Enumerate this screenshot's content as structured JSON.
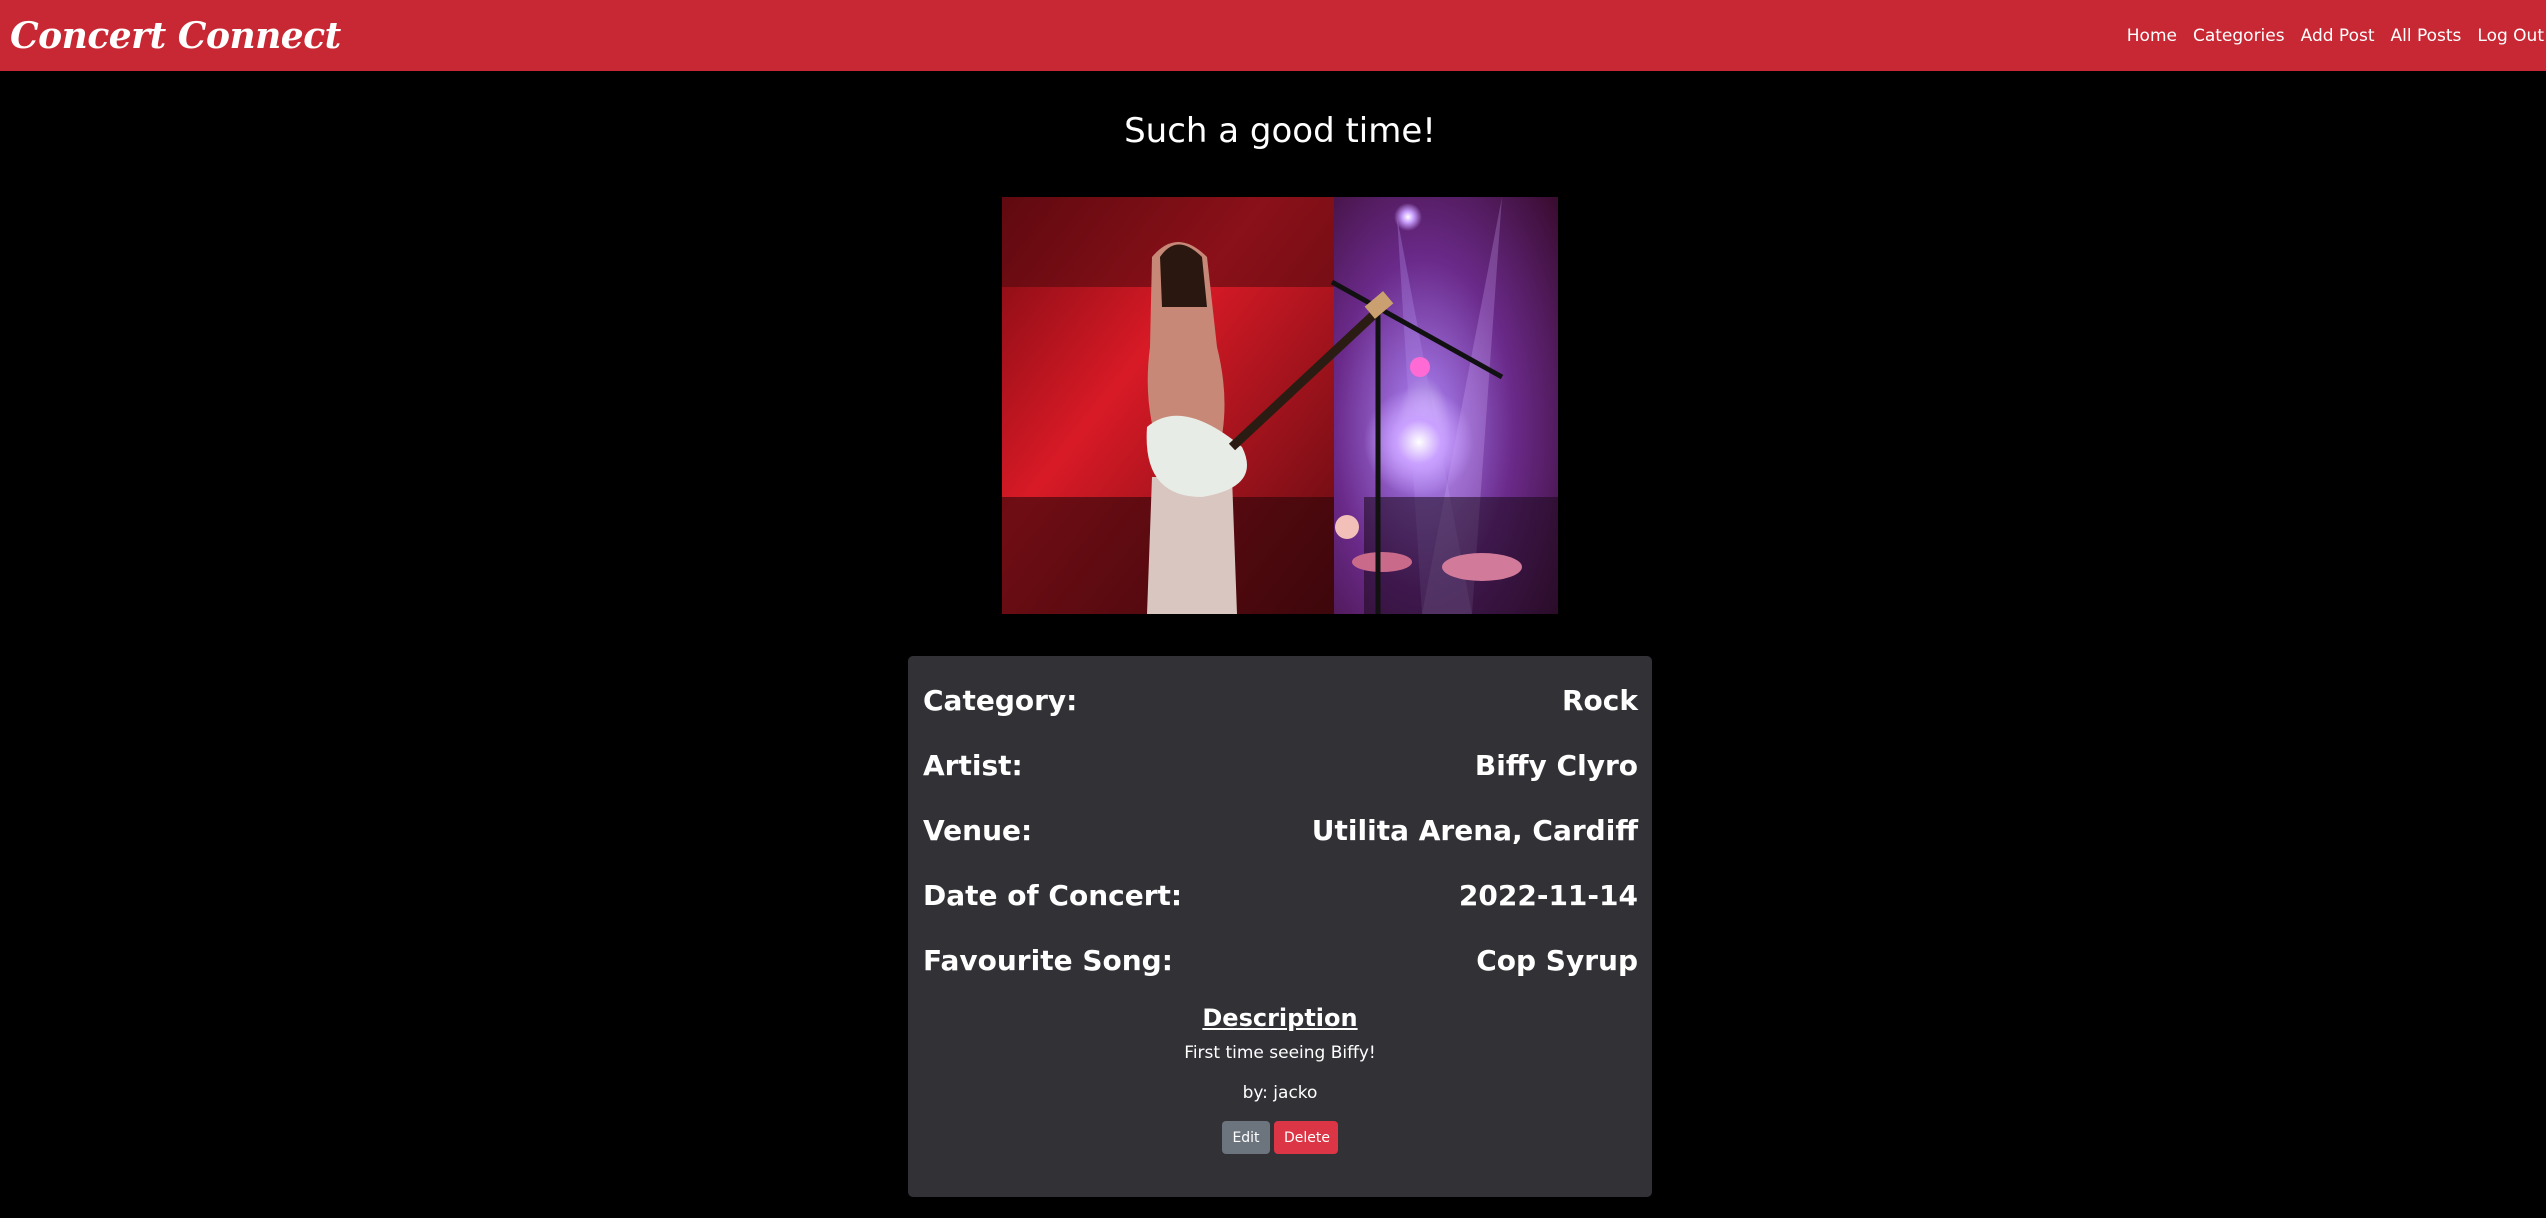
{
  "nav": {
    "brand": "Concert Connect",
    "links": [
      "Home",
      "Categories",
      "Add Post",
      "All Posts",
      "Log Out"
    ]
  },
  "post": {
    "title": "Such a good time!",
    "details": [
      {
        "label": "Category:",
        "value": "Rock"
      },
      {
        "label": "Artist:",
        "value": "Biffy Clyro"
      },
      {
        "label": "Venue:",
        "value": "Utilita Arena, Cardiff"
      },
      {
        "label": "Date of Concert:",
        "value": "2022-11-14"
      },
      {
        "label": "Favourite Song:",
        "value": "Cop Syrup"
      }
    ],
    "description_heading": "Description",
    "description": "First time seeing Biffy!",
    "author": "by: jacko",
    "edit_label": "Edit",
    "delete_label": "Delete"
  },
  "colors": {
    "navbar": "#c82834",
    "card": "#323136",
    "page": "#000000",
    "edit_button": "#6c757d",
    "delete_button": "#dc3545"
  }
}
